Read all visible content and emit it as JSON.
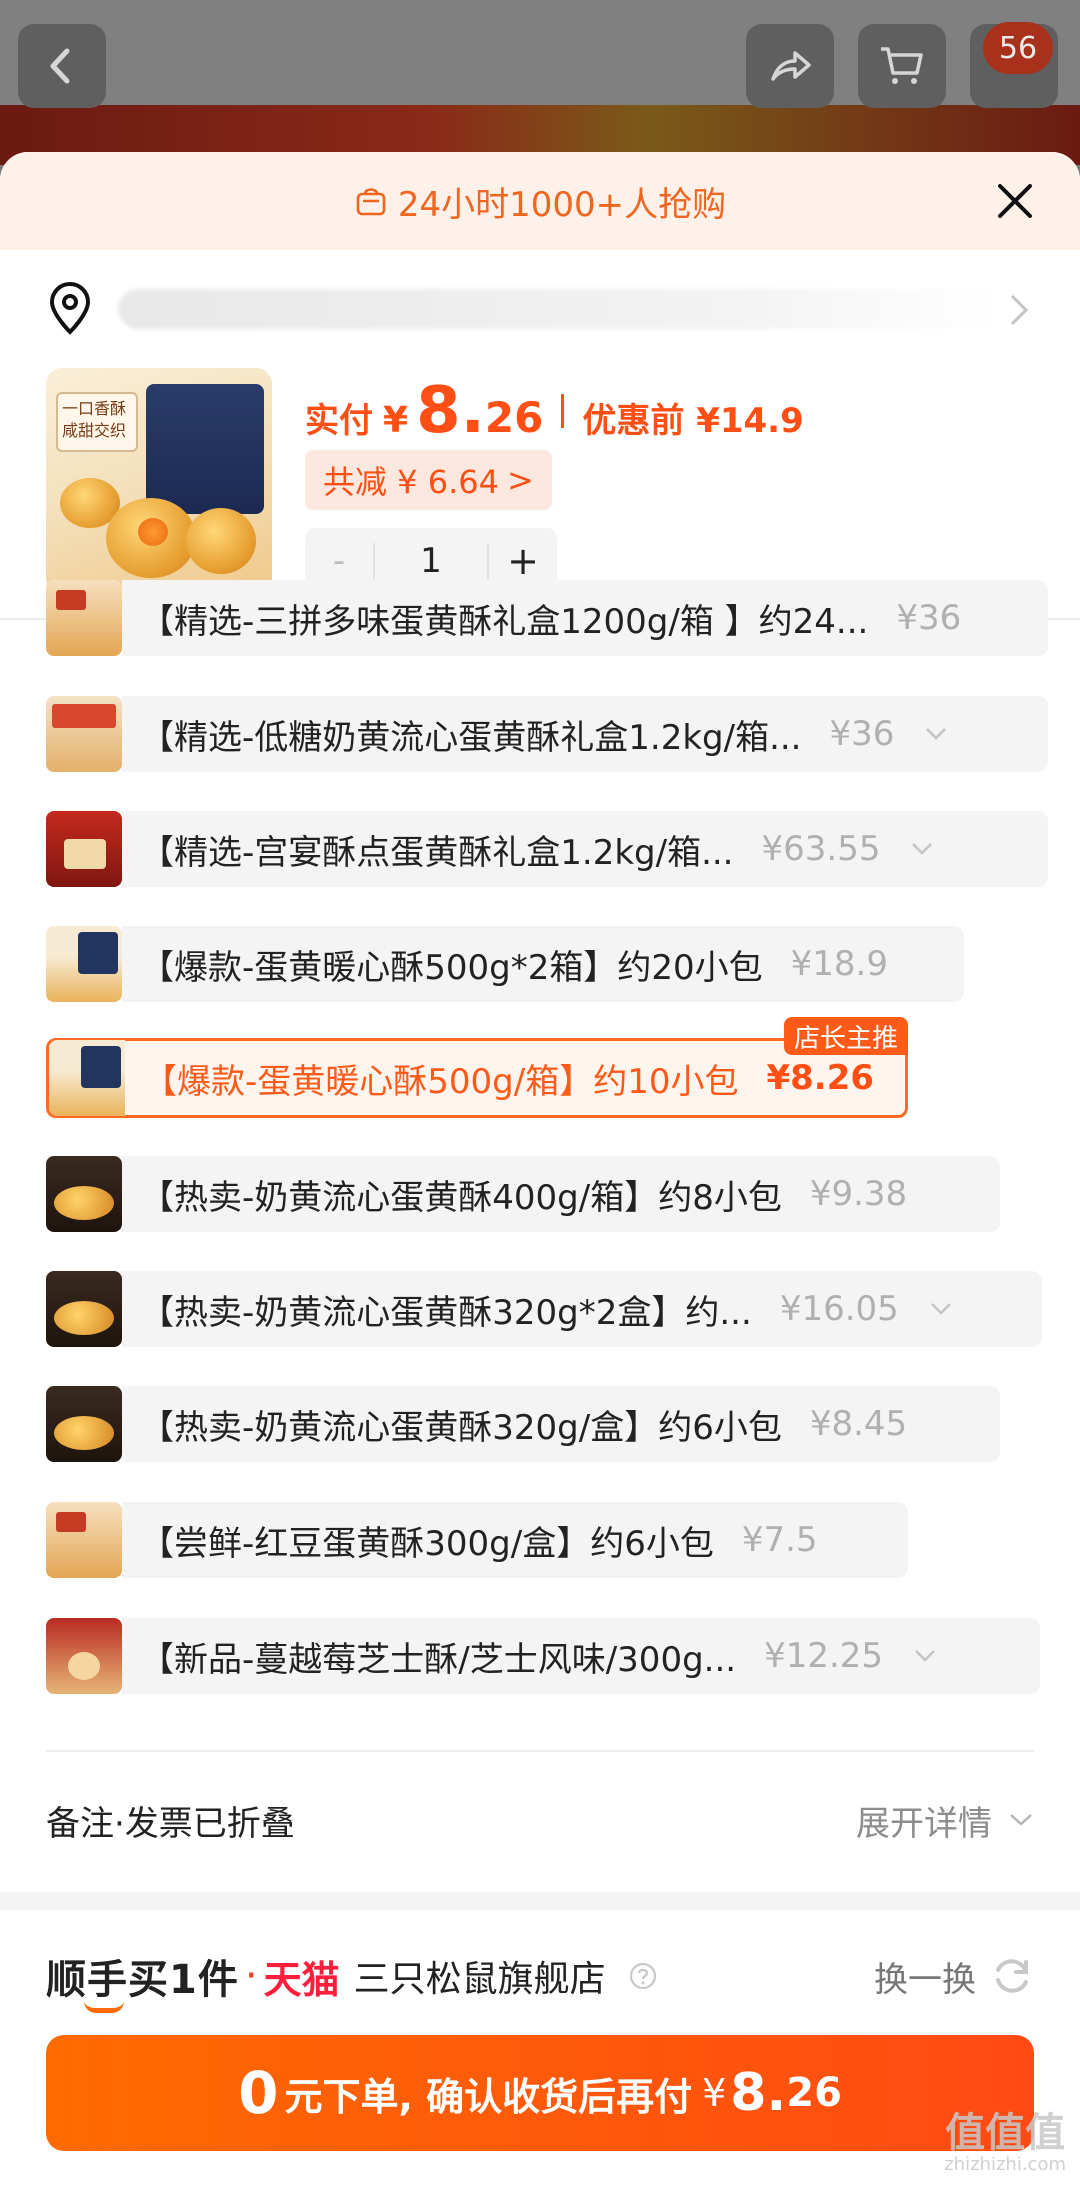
{
  "topbar": {
    "cart_badge": "56"
  },
  "sheet": {
    "hot_text": "24小时1000+人抢购",
    "product": {
      "image_tag": "一口香酥 咸甜交织",
      "price_label": "实付",
      "currency": "¥",
      "price_int": "8.",
      "price_dec": "26",
      "original_label": "优惠前 ¥14.9",
      "saving": "共减 ¥ 6.64",
      "saving_arrow": ">",
      "quantity": "1",
      "minus": "-",
      "plus": "+"
    },
    "variants": [
      {
        "name": "【精选-三拼多味蛋黄酥礼盒1200g/箱 】约24...",
        "price": "¥36",
        "dropdown": false,
        "thumb": "t-cream"
      },
      {
        "name": "【精选-低糖奶黄流心蛋黄酥礼盒1.2kg/箱...",
        "price": "¥36",
        "dropdown": true,
        "thumb": "t-gift"
      },
      {
        "name": "【精选-宫宴酥点蛋黄酥礼盒1.2kg/箱...",
        "price": "¥63.55",
        "dropdown": true,
        "thumb": "t-red"
      },
      {
        "name": "【爆款-蛋黄暖心酥500g*2箱】约20小包",
        "price": "¥18.9",
        "dropdown": false,
        "thumb": "t-blue"
      },
      {
        "name": "【爆款-蛋黄暖心酥500g/箱】约10小包",
        "price": "¥8.26",
        "dropdown": false,
        "thumb": "t-blue",
        "selected": true,
        "tag": "店长主推"
      },
      {
        "name": "【热卖-奶黄流心蛋黄酥400g/箱】约8小包",
        "price": "¥9.38",
        "dropdown": false,
        "thumb": "t-dark"
      },
      {
        "name": "【热卖-奶黄流心蛋黄酥320g*2盒】约...",
        "price": "¥16.05",
        "dropdown": true,
        "thumb": "t-dark"
      },
      {
        "name": "【热卖-奶黄流心蛋黄酥320g/盒】约6小包",
        "price": "¥8.45",
        "dropdown": false,
        "thumb": "t-dark"
      },
      {
        "name": "【尝鲜-红豆蛋黄酥300g/盒】约6小包",
        "price": "¥7.5",
        "dropdown": false,
        "thumb": "t-cream"
      },
      {
        "name": "【新品-蔓越莓芝士酥/芝士风味/300g...",
        "price": "¥12.25",
        "dropdown": true,
        "thumb": "t-berry"
      }
    ],
    "note": {
      "label": "备注·发票已折叠",
      "expand": "展开详情"
    },
    "shop": {
      "brand": "顺手买1件",
      "dot": "·",
      "platform": "天猫",
      "name": "三只松鼠旗舰店",
      "swap": "换一换"
    },
    "cta": {
      "zero": "0",
      "text": "元下单, 确认收货后再付",
      "yen": "¥",
      "amount": "8.",
      "decimal": "26"
    }
  },
  "watermark": {
    "main": "值值值",
    "sub": "zhizhizhi.com"
  },
  "colors": {
    "accent": "#ff4f15",
    "cta": "#ff5a14",
    "tmall": "#ff1e3c"
  }
}
